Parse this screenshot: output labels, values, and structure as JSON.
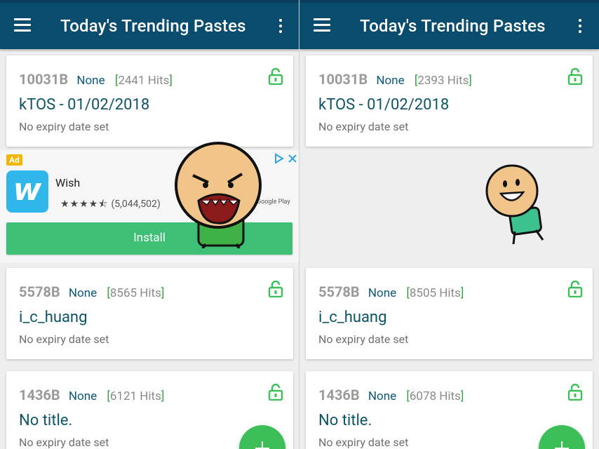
{
  "app": {
    "title": "Today's Trending Pastes"
  },
  "icons": {
    "menu": "hamburger-menu-icon",
    "overflow": "more-vert-icon",
    "lock": "lock-open-icon",
    "fab": "add-icon"
  },
  "colors": {
    "appbar": "#0a4c6e",
    "accent_green": "#3dbf58",
    "title_teal": "#0d5466"
  },
  "left": {
    "pastes": [
      {
        "size": "10031B",
        "syntax": "None",
        "hits": "2441 Hits",
        "title": "kTOS - 01/02/2018",
        "expiry": "No expiry date set"
      },
      {
        "size": "5578B",
        "syntax": "None",
        "hits": "8565 Hits",
        "title": "i_c_huang",
        "expiry": "No expiry date set"
      },
      {
        "size": "1436B",
        "syntax": "None",
        "hits": "6121 Hits",
        "title": "No title.",
        "expiry": "No expiry date set"
      }
    ],
    "ad": {
      "badge": "Ad",
      "app_name": "Wish",
      "logo_letter": "w",
      "rating_stars": "★★★★⯪",
      "rating_count": "(5,044,502)",
      "store": "Google Play",
      "install_label": "Install"
    }
  },
  "right": {
    "pastes": [
      {
        "size": "10031B",
        "syntax": "None",
        "hits": "2393 Hits",
        "title": "kTOS - 01/02/2018",
        "expiry": "No expiry date set"
      },
      {
        "size": "5578B",
        "syntax": "None",
        "hits": "8505 Hits",
        "title": "i_c_huang",
        "expiry": "No expiry date set"
      },
      {
        "size": "1436B",
        "syntax": "None",
        "hits": "6078 Hits",
        "title": "No title.",
        "expiry": "No expiry date set"
      }
    ]
  }
}
